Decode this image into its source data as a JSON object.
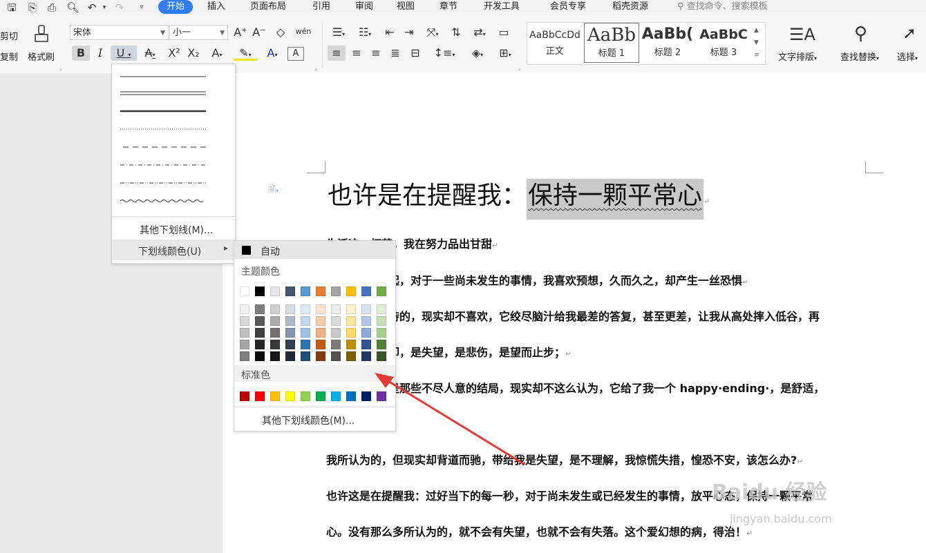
{
  "menubar": {
    "tabs": [
      "开始",
      "插入",
      "页面布局",
      "引用",
      "审阅",
      "视图",
      "章节",
      "开发工具",
      "会员专享",
      "稻壳资源"
    ],
    "active_tab": "开始",
    "search": "查找命令、搜索模板"
  },
  "ribbon": {
    "cut": "剪切",
    "copy": "复制",
    "format_painter": "格式刷",
    "font_name": "宋体",
    "font_size": "小一",
    "pinyin_glyph": "wén",
    "styles": [
      {
        "preview": "AaBbCcDd",
        "name": "正文"
      },
      {
        "preview": "AaBb",
        "name": "标题 1"
      },
      {
        "preview": "AaBb(",
        "name": "标题 2"
      },
      {
        "preview": "AaBbC",
        "name": "标题 3"
      }
    ],
    "text_layout": "文字排版",
    "find_replace": "查找替换",
    "select": "选择"
  },
  "underline_menu": {
    "more_underlines": "其他下划线(M)...",
    "underline_color": "下划线颜色(U)"
  },
  "color_panel": {
    "auto": "自动",
    "theme_colors_label": "主题颜色",
    "standard_colors_label": "标准色",
    "more_colors": "其他下划线颜色(M)...",
    "theme_top": [
      "#ffffff",
      "#000000",
      "#e7e6e6",
      "#44546a",
      "#5b9bd5",
      "#ed7d31",
      "#a5a5a5",
      "#ffc000",
      "#4472c4",
      "#70ad47"
    ],
    "theme_shades": [
      [
        "#f2f2f2",
        "#7f7f7f",
        "#d0cece",
        "#d6dce4",
        "#deebf6",
        "#fbe5d5",
        "#ededed",
        "#fff2cc",
        "#d9e2f3",
        "#e2efd9"
      ],
      [
        "#d8d8d8",
        "#595959",
        "#aeabab",
        "#adb9ca",
        "#bdd7ee",
        "#f7cbac",
        "#dbdbdb",
        "#fee599",
        "#b4c6e7",
        "#c5e0b3"
      ],
      [
        "#bfbfbf",
        "#3f3f3f",
        "#757070",
        "#8496b0",
        "#9cc3e5",
        "#f4b183",
        "#c9c9c9",
        "#ffd965",
        "#8eaadb",
        "#a8d08d"
      ],
      [
        "#a5a5a5",
        "#262626",
        "#3a3838",
        "#333f4f",
        "#2e75b5",
        "#c55a11",
        "#7b7b7b",
        "#bf9000",
        "#2f5496",
        "#538135"
      ],
      [
        "#7f7f7f",
        "#0c0c0c",
        "#171616",
        "#222a35",
        "#1f4e79",
        "#833c0b",
        "#525252",
        "#7f6000",
        "#1f3864",
        "#375623"
      ]
    ],
    "standard": [
      "#c00000",
      "#ff0000",
      "#ffc000",
      "#ffff00",
      "#92d050",
      "#00b050",
      "#00b0f0",
      "#0070c0",
      "#002060",
      "#7030a0"
    ]
  },
  "document": {
    "title_plain": "也许是在提醒我：",
    "title_selected": "保持一颗平常心",
    "lines": [
      "生活这一杯茶，我在努力品出甘甜",
      "起，对于一些尚未发生的事情，我喜欢预想，久而久之，却产生一丝恐惧",
      "待的，现实却不喜欢，它绞尽脑汁给我最差的答复，甚至更差，让我从高处摔入低谷，再",
      "却，是失望，是悲伤，是望而止步；",
      "是那些不尽人意的结局，现实却不这么认为，它给了我一个 happy·ending·，是舒适，",
      "我所认为的，但现实却背道而驰，带给我是失望，是不理解，我惊慌失措，惶恐不安，该怎么办?",
      "也许这是在提醒我：过好当下的每一秒，对于尚未发生或已经发生的事情，放平心态，保持一颗平常",
      "心。没有那么多所认为的，就不会有失望，也就不会有失落。这个爱幻想的病，得治！"
    ]
  },
  "watermark": {
    "brand": "Baidu 经验",
    "url": "jingyan.baidu.com"
  }
}
